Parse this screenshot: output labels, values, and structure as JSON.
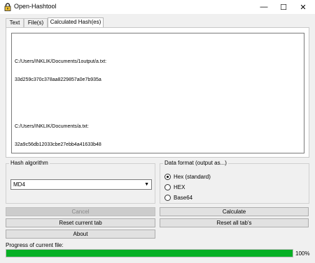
{
  "window": {
    "title": "Open-Hashtool",
    "minimize_glyph": "—",
    "maximize_glyph": "☐",
    "close_glyph": "✕"
  },
  "tabs": [
    {
      "label": "Text",
      "active": false
    },
    {
      "label": "File(s)",
      "active": false
    },
    {
      "label": "Calculated Hash(es)",
      "active": true
    }
  ],
  "results": [
    {
      "path": "C:/Users/INKLIK/Documents/1output/a.txt:",
      "hash": "33d259c370c378aa8229857a0e7b935a"
    },
    {
      "path": "C:/Users/INKLIK/Documents/a.txt:",
      "hash": "32a9c56db12033cbe27ebb4a41633b48"
    }
  ],
  "hash_algorithm": {
    "group_title": "Hash algorithm",
    "selected": "MD4"
  },
  "data_format": {
    "group_title": "Data format (output as...)",
    "options": [
      {
        "label": "Hex (standard)",
        "checked": true
      },
      {
        "label": "HEX",
        "checked": false
      },
      {
        "label": "Base64",
        "checked": false
      }
    ]
  },
  "buttons": {
    "cancel": "Cancel",
    "calculate": "Calculate",
    "reset_current_tab": "Reset current tab",
    "reset_all_tabs": "Reset all tab's",
    "about": "About"
  },
  "progress": {
    "label": "Progress of current file:",
    "value_text": "100%",
    "fraction": 1.0
  },
  "colors": {
    "progress_fill": "#06b025",
    "window_bg": "#f0f0f0"
  }
}
